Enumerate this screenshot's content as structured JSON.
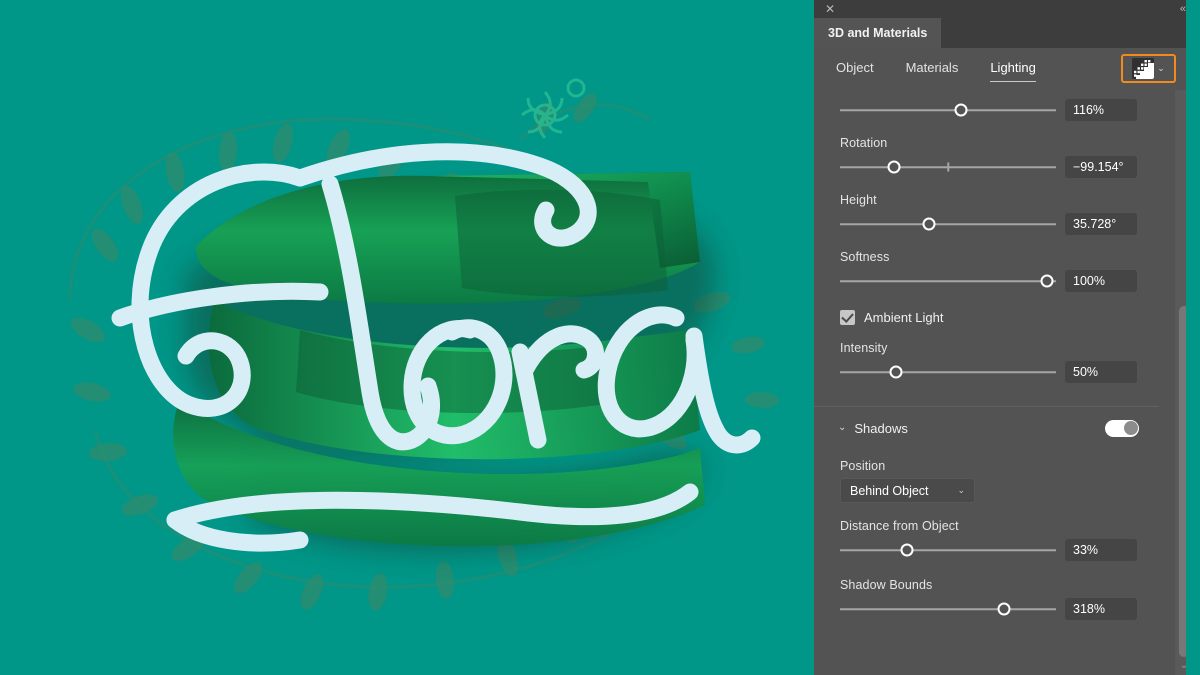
{
  "canvas": {
    "background_color": "#009688",
    "artwork_title": "Flora",
    "artwork_letter_color": "#d7eef6",
    "artwork_extrude_color": "#18a158",
    "artwork_shadow_color": "#1b4d3b",
    "leaf_color": "#2f8c6d"
  },
  "panel": {
    "close_icon": "✕",
    "collapse_icon": "«",
    "tab_label": "3D and Materials",
    "subtabs": [
      {
        "label": "Object",
        "active": false
      },
      {
        "label": "Materials",
        "active": false
      },
      {
        "label": "Lighting",
        "active": true
      }
    ],
    "preset_button": {
      "name": "lighting-preset",
      "chevron": "⌄",
      "highlight_color": "#f08c1e"
    },
    "controls": [
      {
        "label": "",
        "value": "116%",
        "knob_pct": 56,
        "has_tick": false
      },
      {
        "label": "Rotation",
        "value": "−99.154°",
        "knob_pct": 25,
        "has_tick": true,
        "tick_pct": 50
      },
      {
        "label": "Height",
        "value": "35.728°",
        "knob_pct": 41,
        "has_tick": false
      },
      {
        "label": "Softness",
        "value": "100%",
        "knob_pct": 96,
        "has_tick": false
      }
    ],
    "ambient": {
      "checkbox_label": "Ambient Light",
      "checked": true,
      "intensity_label": "Intensity",
      "intensity_value": "50%",
      "intensity_knob_pct": 26
    },
    "shadows": {
      "section_title": "Shadows",
      "section_chevron": "⌄",
      "enabled": true,
      "position_label": "Position",
      "position_value": "Behind Object",
      "position_chevron": "⌄",
      "distance_label": "Distance from Object",
      "distance_value": "33%",
      "distance_knob_pct": 31,
      "bounds_label": "Shadow Bounds",
      "bounds_value": "318%",
      "bounds_knob_pct": 76
    },
    "scrollbar": {
      "thumb_top_pct": 37,
      "thumb_height_pct": 60,
      "down_arrow": "⌄"
    }
  }
}
